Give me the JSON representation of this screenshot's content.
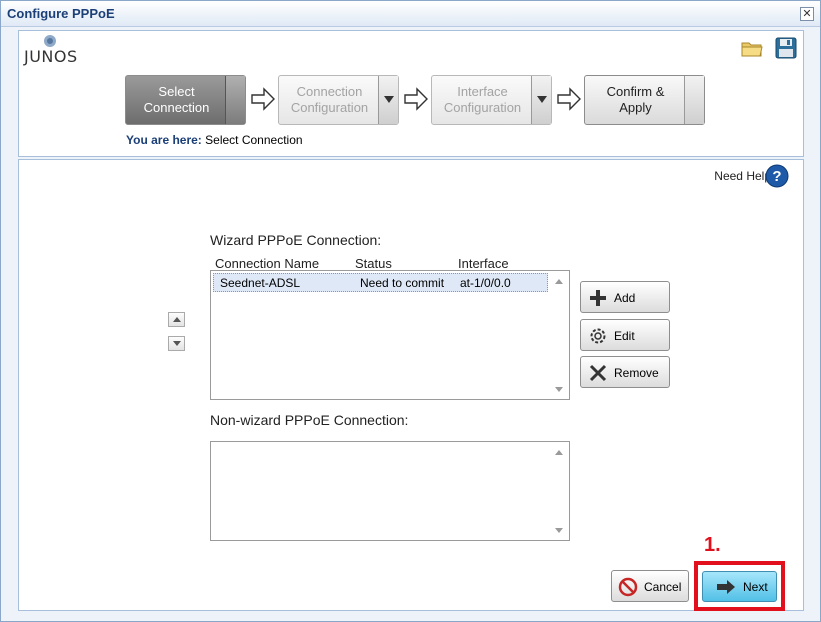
{
  "window": {
    "title": "Configure PPPoE",
    "close_glyph": "✕"
  },
  "brand": {
    "logo_text": "JUNOS"
  },
  "toolbar": {
    "open_icon": "folder-icon",
    "save_icon": "floppy-disk-icon"
  },
  "wizard": {
    "steps": [
      {
        "label_line1": "Select",
        "label_line2": "Connection",
        "state": "active"
      },
      {
        "label_line1": "Connection",
        "label_line2": "Configuration",
        "state": "disabled"
      },
      {
        "label_line1": "Interface",
        "label_line2": "Configuration",
        "state": "disabled"
      },
      {
        "label_line1": "Confirm &",
        "label_line2": "Apply",
        "state": "enabled"
      }
    ],
    "you_are_here_label": "You are here:",
    "you_are_here_value": "Select Connection"
  },
  "help": {
    "label": "Need Help"
  },
  "wizard_connections": {
    "label": "Wizard PPPoE Connection:",
    "columns": [
      "Connection Name",
      "Status",
      "Interface"
    ],
    "rows": [
      {
        "name": "Seednet-ADSL",
        "status": "Need to commit",
        "interface": "at-1/0/0.0"
      }
    ]
  },
  "actions": {
    "add": "Add",
    "edit": "Edit",
    "remove": "Remove"
  },
  "non_wizard_connections": {
    "label": "Non-wizard PPPoE Connection:",
    "rows": []
  },
  "footer": {
    "cancel": "Cancel",
    "next": "Next",
    "annotation": "1."
  },
  "colors": {
    "annotation_red": "#e2101d",
    "next_blue": "#52c0e6",
    "title_blue": "#1b3f77"
  }
}
